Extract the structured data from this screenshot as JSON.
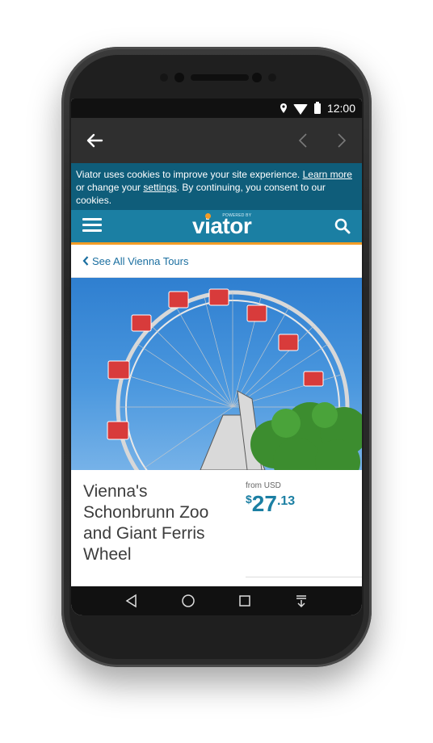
{
  "status_bar": {
    "time": "12:00"
  },
  "cookie_banner": {
    "text_1": "Viator uses cookies to improve your site experience. ",
    "learn_more": "Learn more",
    "text_2": " or change your ",
    "settings": "settings",
    "text_3": ". By continuing, you consent to our cookies."
  },
  "header": {
    "logo": "viator",
    "powered_by": "POWERED BY"
  },
  "breadcrumb": {
    "label": "See All Vienna Tours"
  },
  "tour": {
    "title": "Vienna's Schonbrunn Zoo and Giant Ferris Wheel",
    "from_label": "from USD",
    "price_currency": "$",
    "price_whole": "27",
    "price_cents": ".13"
  },
  "colors": {
    "brand_blue": "#1b7fa3",
    "brand_orange": "#f39c26",
    "cookie_bg": "#0f5d7a"
  },
  "icons": {
    "back": "arrow-left-icon",
    "prev": "chevron-left-icon",
    "next": "chevron-right-icon",
    "menu": "hamburger-menu-icon",
    "search": "search-icon",
    "sys_back": "triangle-back-icon",
    "sys_home": "circle-home-icon",
    "sys_recent": "square-recents-icon",
    "sys_notif": "notification-down-icon"
  }
}
